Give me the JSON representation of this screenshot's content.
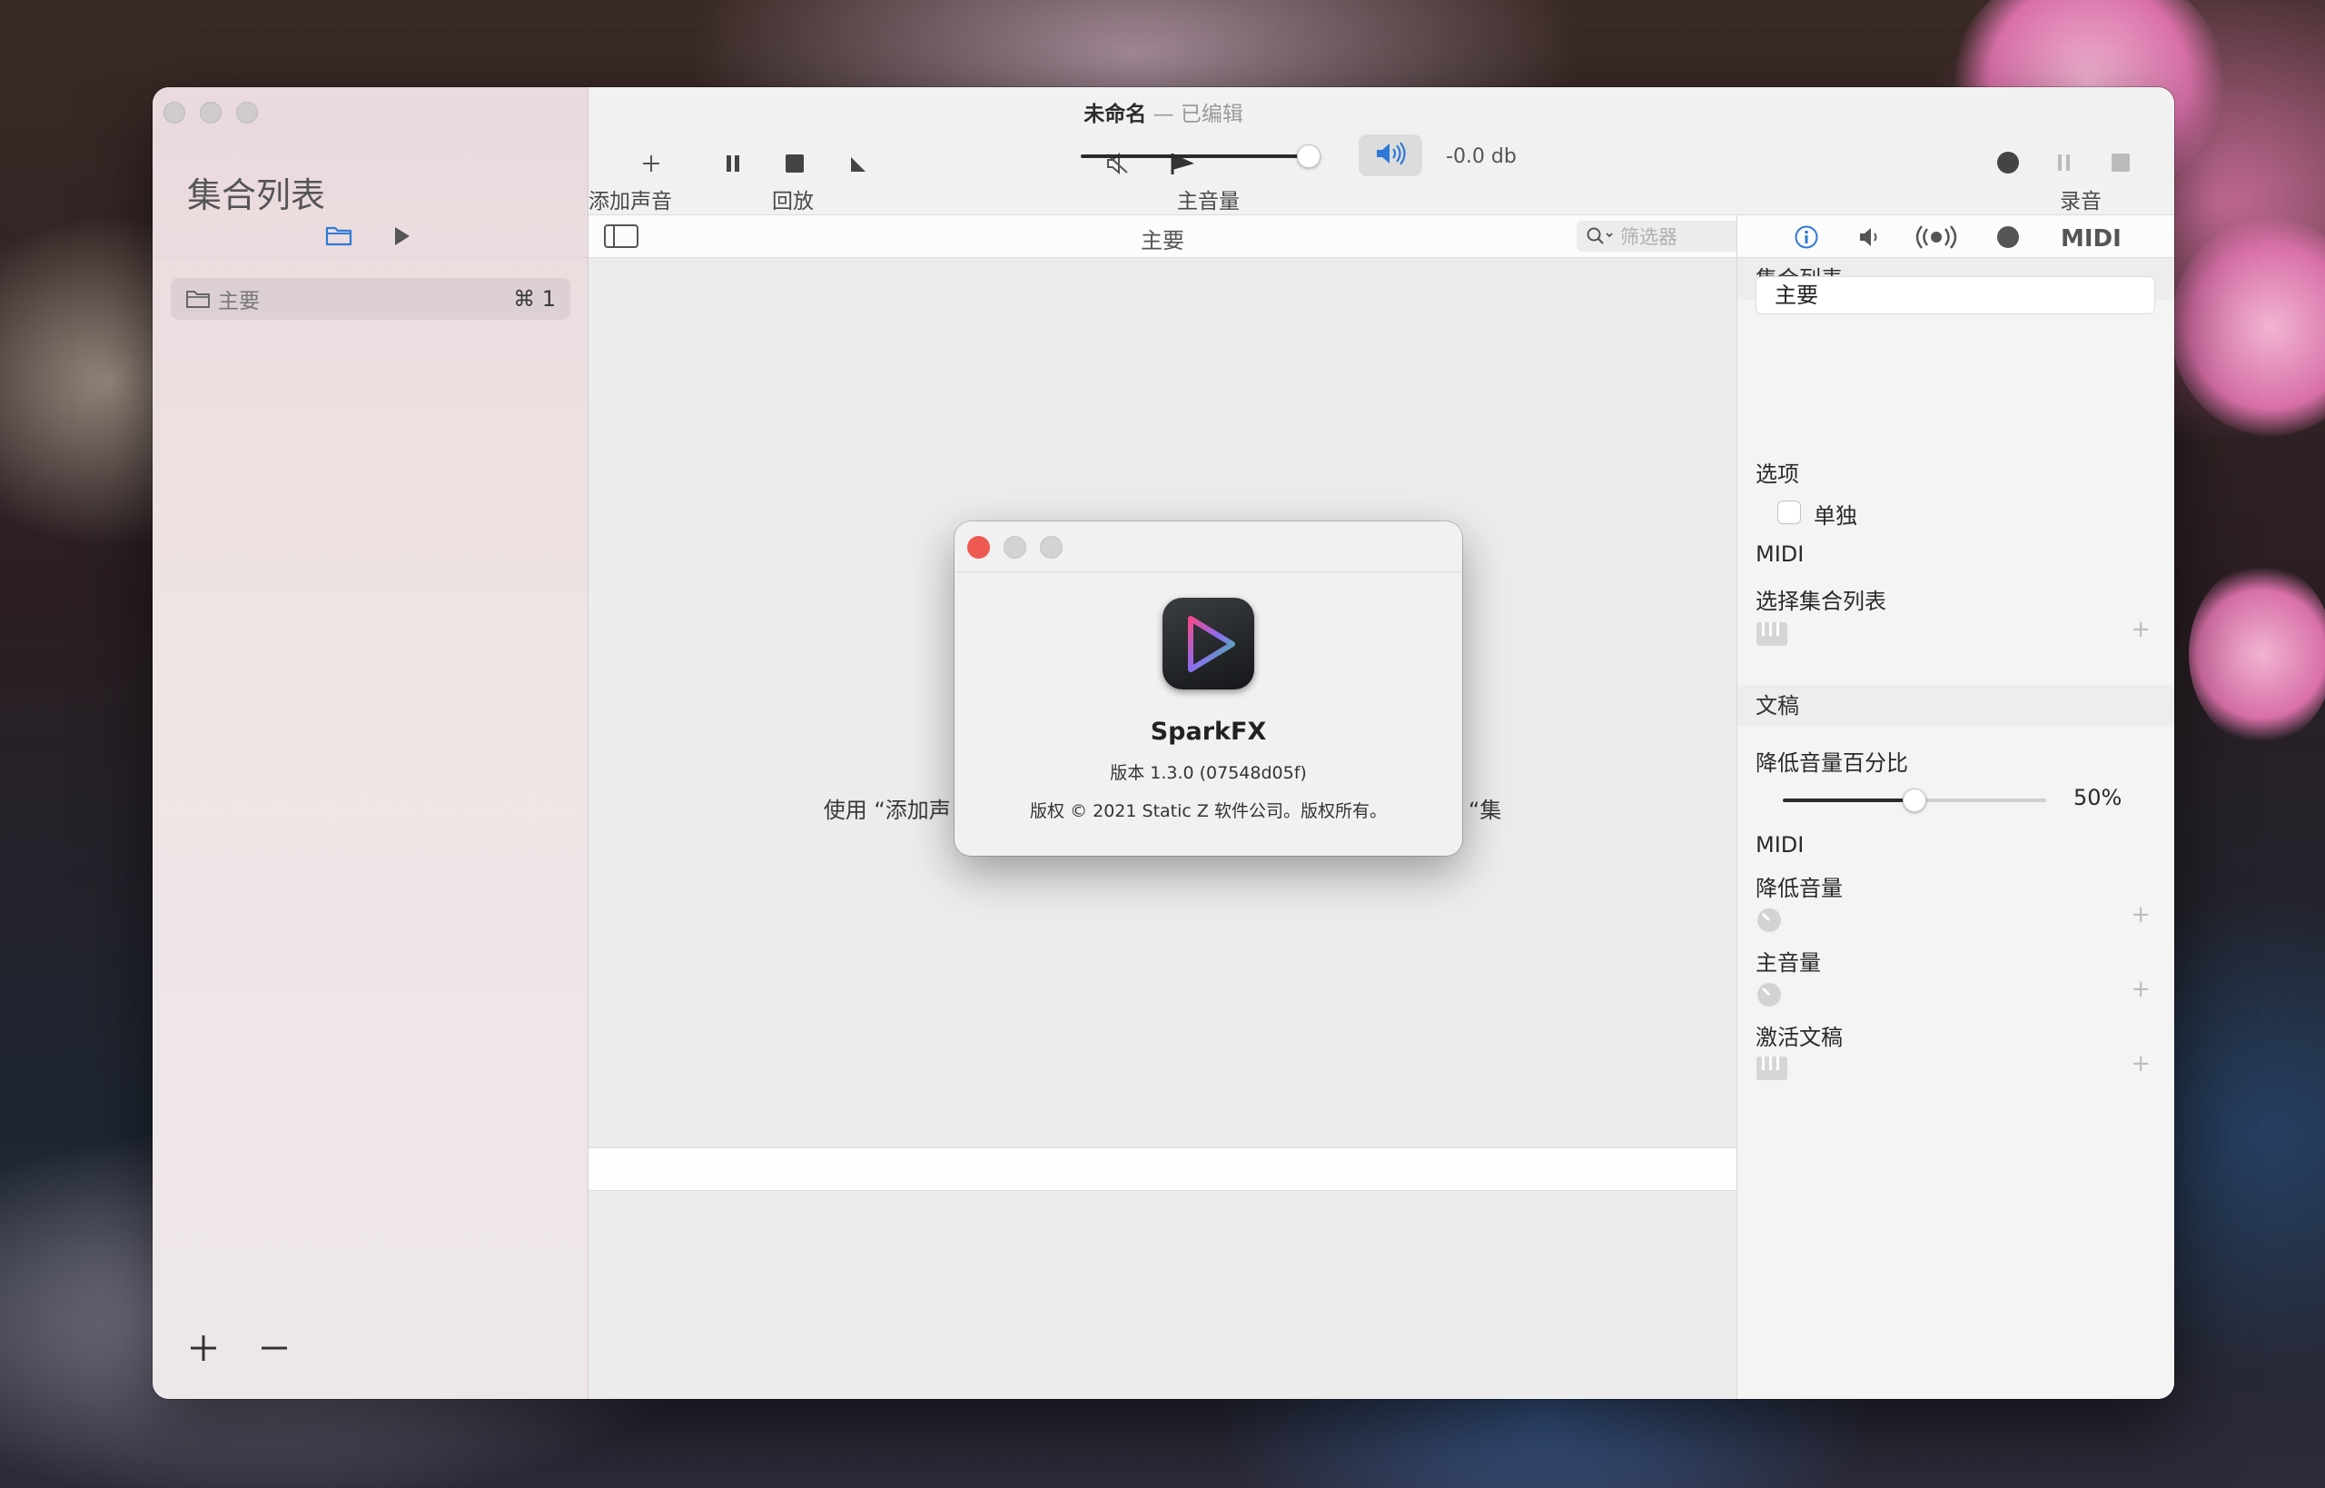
{
  "window": {
    "title": "未命名",
    "title_separator": "—",
    "title_state": "已编辑"
  },
  "sidebar": {
    "title": "集合列表",
    "items": [
      {
        "label": "主要",
        "shortcut": "⌘ 1"
      }
    ],
    "add_icon": "plus-icon",
    "remove_icon": "minus-icon"
  },
  "toolbar": {
    "add_sound_label": "添加声音",
    "playback_label": "回放",
    "master_volume_label": "主音量",
    "record_label": "录音",
    "volume_db": "-0.0 db",
    "volume_level": 0.95,
    "accent_color": "#2e79d6"
  },
  "content": {
    "title": "主要",
    "filter_placeholder": "筛选器",
    "hint_left": "使用 “添加声",
    "hint_right": "“集"
  },
  "inspector": {
    "tabs": [
      "info-icon",
      "speaker-icon",
      "broadcast-icon",
      "record-icon",
      "midi-icon"
    ],
    "section_cue_list": "集合列表",
    "name_value": "主要",
    "options_label": "选项",
    "solo_label": "单独",
    "solo_checked": false,
    "midi_label": "MIDI",
    "select_cue_list_label": "选择集合列表",
    "section_script": "文稿",
    "duck_percent_label": "降低音量百分比",
    "duck_percent_value": "50%",
    "duck_percent_level": 0.5,
    "midi_label_2": "MIDI",
    "duck_volume_label": "降低音量",
    "master_volume_label": "主音量",
    "activate_script_label": "激活文稿"
  },
  "about": {
    "app_name": "SparkFX",
    "version": "版本 1.3.0 (07548d05f)",
    "copyright": "版权 © 2021 Static Z 软件公司。版权所有。",
    "close_color": "#ee5a52"
  }
}
